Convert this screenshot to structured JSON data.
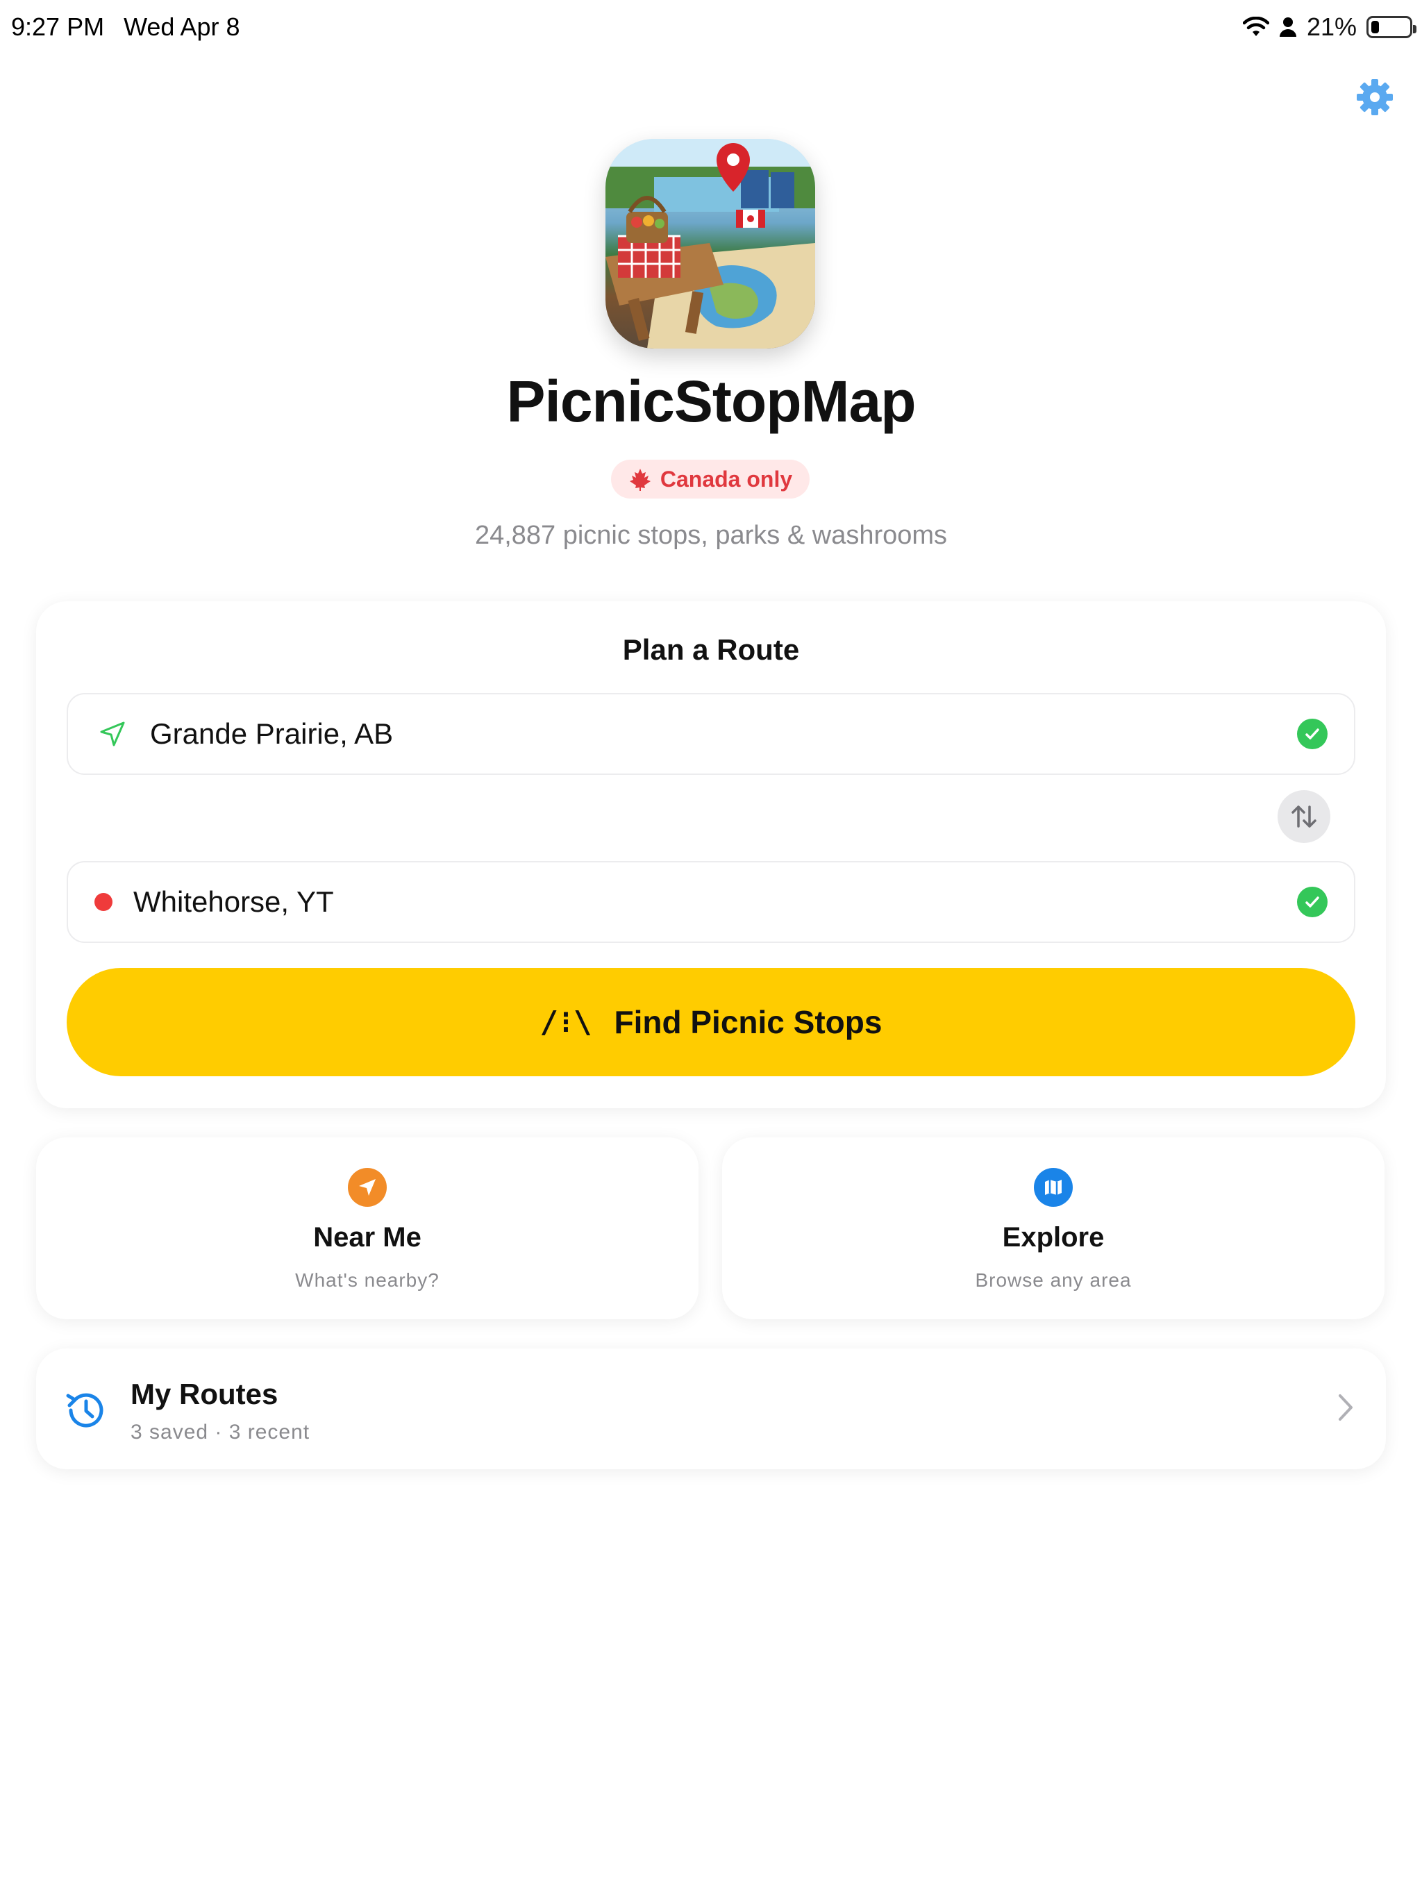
{
  "status_bar": {
    "time": "9:27 PM",
    "date": "Wed Apr 8",
    "battery_percent": "21%",
    "battery_level": 0.21
  },
  "app": {
    "title": "PicnicStopMap",
    "badge": "Canada only",
    "stats": "24,887 picnic stops, parks & washrooms"
  },
  "route_card": {
    "title": "Plan a Route",
    "from": "Grande Prairie, AB",
    "to": "Whitehorse, YT",
    "find_button": "Find Picnic Stops",
    "road_glyph": "/⁝\\"
  },
  "quick_actions": {
    "near_me": {
      "title": "Near Me",
      "subtitle": "What's nearby?"
    },
    "explore": {
      "title": "Explore",
      "subtitle": "Browse any area"
    }
  },
  "my_routes": {
    "title": "My Routes",
    "subtitle": "3 saved · 3 recent"
  },
  "colors": {
    "accent_yellow": "#ffcc00",
    "check_green": "#34c759",
    "destination_red": "#ef3b3b",
    "near_me_orange": "#f28c28",
    "explore_blue": "#1a84e8",
    "settings_blue": "#5aa9f0",
    "badge_bg": "#ffe8e8",
    "badge_text": "#e0383e"
  },
  "icons": {
    "settings": "gear-icon",
    "from": "location-arrow-icon",
    "to": "red-dot-icon",
    "check": "checkmark-circle-icon",
    "swap": "swap-vertical-icon",
    "find": "road-icon",
    "near_me": "navigation-arrow-icon",
    "explore": "map-icon",
    "routes": "history-clock-icon",
    "chevron": "chevron-right-icon",
    "badge": "maple-leaf-icon"
  }
}
